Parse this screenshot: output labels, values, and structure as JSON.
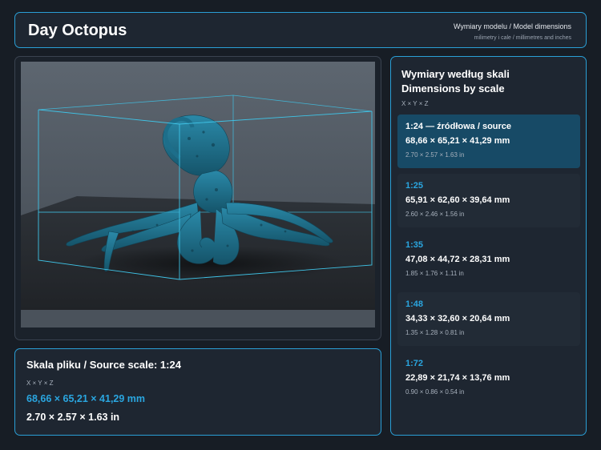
{
  "header": {
    "title": "Day Octopus",
    "subtitle": "Wymiary modelu / Model dimensions",
    "units_note": "milimetry i cale / millimetres and inches"
  },
  "source_scale": {
    "heading": "Skala pliku / Source scale: 1:24",
    "axes": "X × Y × Z",
    "mm": "68,66 × 65,21 × 41,29 mm",
    "in": "2.70 × 2.57 × 1.63 in"
  },
  "scales": {
    "heading_line1": "Wymiary według skali",
    "heading_line2": "Dimensions by scale",
    "axes": "X × Y × Z",
    "items": [
      {
        "label": "1:24  —  źródłowa / source",
        "mm": "68,66 × 65,21 × 41,29 mm",
        "in": "2.70 × 2.57 × 1.63 in"
      },
      {
        "label": "1:25",
        "mm": "65,91 × 62,60 × 39,64 mm",
        "in": "2.60 × 2.46 × 1.56 in"
      },
      {
        "label": "1:35",
        "mm": "47,08 × 44,72 × 28,31 mm",
        "in": "1.85 × 1.76 × 1.11 in"
      },
      {
        "label": "1:48",
        "mm": "34,33 × 32,60 × 20,64 mm",
        "in": "1.35 × 1.28 × 0.81 in"
      },
      {
        "label": "1:72",
        "mm": "22,89 × 21,74 × 13,76 mm",
        "in": "0.90 × 0.86 × 0.54 in"
      }
    ]
  },
  "colors": {
    "accent": "#2aa6e0",
    "background": "#171d25",
    "panel": "#1e2631",
    "selected_card": "#174a66",
    "model": "#1d6e8a"
  }
}
